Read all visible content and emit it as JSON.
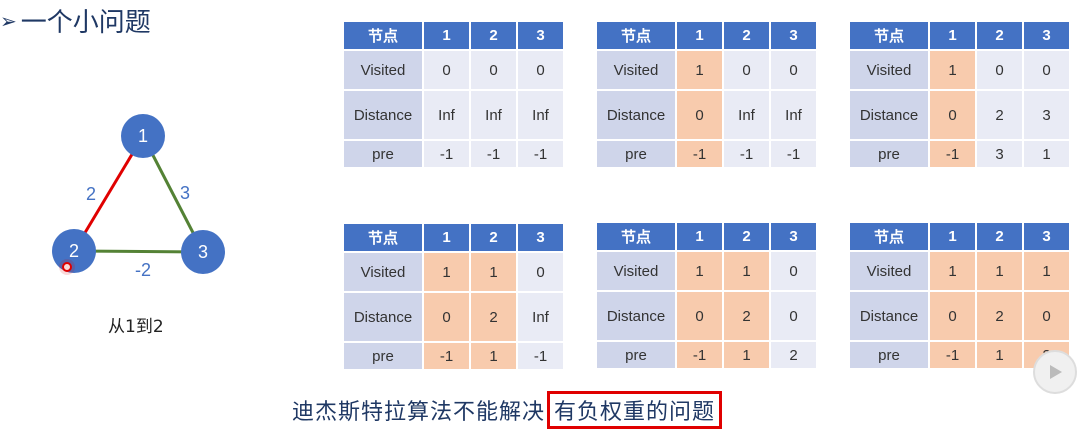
{
  "title": "一个小问题",
  "graph": {
    "nodes": [
      "1",
      "2",
      "3"
    ],
    "edges": [
      {
        "from": "1",
        "to": "2",
        "weight": "2"
      },
      {
        "from": "1",
        "to": "3",
        "weight": "3"
      },
      {
        "from": "2",
        "to": "3",
        "weight": "-2"
      }
    ],
    "caption": "从1到2",
    "colors": {
      "node": "#4472c4",
      "edge_red": "#e00000",
      "edge_green": "#548235"
    }
  },
  "table_headers": {
    "node": "节点",
    "cols": [
      "1",
      "2",
      "3"
    ]
  },
  "row_labels": [
    "Visited",
    "Distance",
    "pre"
  ],
  "tables": [
    {
      "rows": [
        [
          "0",
          "0",
          "0"
        ],
        [
          "Inf",
          "Inf",
          "Inf"
        ],
        [
          "-1",
          "-1",
          "-1"
        ]
      ],
      "highlight": []
    },
    {
      "rows": [
        [
          "1",
          "0",
          "0"
        ],
        [
          "0",
          "Inf",
          "Inf"
        ],
        [
          "-1",
          "-1",
          "-1"
        ]
      ],
      "highlight": [
        0
      ]
    },
    {
      "rows": [
        [
          "1",
          "0",
          "0"
        ],
        [
          "0",
          "2",
          "3"
        ],
        [
          "-1",
          "3",
          "1"
        ]
      ],
      "highlight": [
        0
      ]
    },
    {
      "rows": [
        [
          "1",
          "1",
          "0"
        ],
        [
          "0",
          "2",
          "Inf"
        ],
        [
          "-1",
          "1",
          "-1"
        ]
      ],
      "highlight": [
        0,
        1
      ]
    },
    {
      "rows": [
        [
          "1",
          "1",
          "0"
        ],
        [
          "0",
          "2",
          "0"
        ],
        [
          "-1",
          "1",
          "2"
        ]
      ],
      "highlight": [
        0,
        1
      ]
    },
    {
      "rows": [
        [
          "1",
          "1",
          "1"
        ],
        [
          "0",
          "2",
          "0"
        ],
        [
          "-1",
          "1",
          "2"
        ]
      ],
      "highlight": [
        0,
        1,
        2
      ]
    }
  ],
  "subtitle": {
    "prefix": "迪杰斯特拉算法不能解决",
    "boxed": "有负权重的问题"
  }
}
